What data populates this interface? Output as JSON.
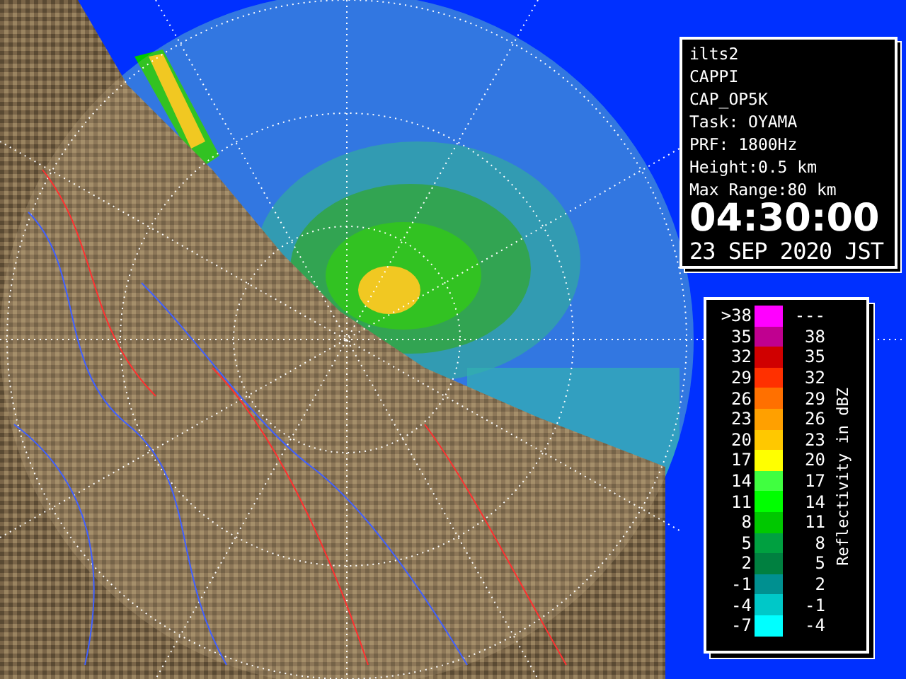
{
  "info": {
    "lines": [
      "ilts2",
      "CAPPI",
      "CAP_OP5K",
      "Task: OYAMA",
      "PRF: 1800Hz",
      "Height:0.5 km",
      "Max Range:80 km"
    ],
    "time": "04:30:00",
    "date": "23 SEP 2020 JST"
  },
  "legend": {
    "title": "Reflectivity in dBZ",
    "rows": [
      {
        "low": ">38",
        "high": "---",
        "color": "#ff00ff"
      },
      {
        "low": "35",
        "high": "38",
        "color": "#c00090"
      },
      {
        "low": "32",
        "high": "35",
        "color": "#d00000"
      },
      {
        "low": "29",
        "high": "32",
        "color": "#ff3000"
      },
      {
        "low": "26",
        "high": "29",
        "color": "#ff7000"
      },
      {
        "low": "23",
        "high": "26",
        "color": "#ffa000"
      },
      {
        "low": "20",
        "high": "23",
        "color": "#ffc800"
      },
      {
        "low": "17",
        "high": "20",
        "color": "#ffff00"
      },
      {
        "low": "14",
        "high": "17",
        "color": "#40ff40"
      },
      {
        "low": "11",
        "high": "14",
        "color": "#00ff00"
      },
      {
        "low": "8",
        "high": "11",
        "color": "#00c800"
      },
      {
        "low": "5",
        "high": "8",
        "color": "#00a040"
      },
      {
        "low": "2",
        "high": "5",
        "color": "#008040"
      },
      {
        "low": "-1",
        "high": "2",
        "color": "#009090"
      },
      {
        "low": "-4",
        "high": "-1",
        "color": "#00c8c8"
      },
      {
        "low": "-7",
        "high": "-4",
        "color": "#00ffff"
      }
    ]
  }
}
